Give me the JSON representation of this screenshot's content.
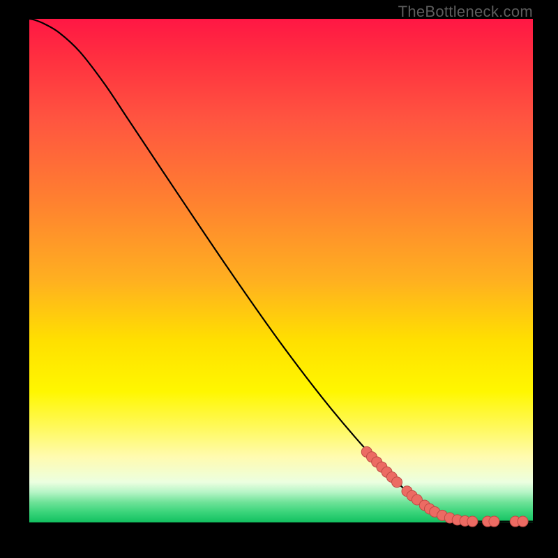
{
  "watermark": "TheBottleneck.com",
  "colors": {
    "background": "#000000",
    "curve": "#000000",
    "dot_fill": "#ec6b63",
    "dot_stroke": "#be4a44"
  },
  "chart_data": {
    "type": "line",
    "title": "",
    "xlabel": "",
    "ylabel": "",
    "xlim": [
      0,
      100
    ],
    "ylim": [
      0,
      100
    ],
    "grid": false,
    "curve": [
      {
        "x": 0.0,
        "y": 100.0
      },
      {
        "x": 1.0,
        "y": 99.8
      },
      {
        "x": 3.0,
        "y": 99.0
      },
      {
        "x": 6.0,
        "y": 97.2
      },
      {
        "x": 10.0,
        "y": 93.5
      },
      {
        "x": 15.0,
        "y": 87.0
      },
      {
        "x": 20.0,
        "y": 79.5
      },
      {
        "x": 30.0,
        "y": 64.5
      },
      {
        "x": 40.0,
        "y": 49.7
      },
      {
        "x": 50.0,
        "y": 35.5
      },
      {
        "x": 60.0,
        "y": 22.5
      },
      {
        "x": 70.0,
        "y": 11.0
      },
      {
        "x": 75.0,
        "y": 6.2
      },
      {
        "x": 80.0,
        "y": 2.5
      },
      {
        "x": 83.0,
        "y": 1.0
      },
      {
        "x": 86.0,
        "y": 0.35
      },
      {
        "x": 90.0,
        "y": 0.2
      },
      {
        "x": 95.0,
        "y": 0.2
      },
      {
        "x": 100.0,
        "y": 0.2
      }
    ],
    "dots": [
      {
        "x": 67.0,
        "y": 14.0
      },
      {
        "x": 68.0,
        "y": 13.0
      },
      {
        "x": 69.0,
        "y": 12.0
      },
      {
        "x": 70.0,
        "y": 11.0
      },
      {
        "x": 71.0,
        "y": 10.0
      },
      {
        "x": 72.0,
        "y": 9.0
      },
      {
        "x": 73.0,
        "y": 8.0
      },
      {
        "x": 75.0,
        "y": 6.2
      },
      {
        "x": 76.0,
        "y": 5.3
      },
      {
        "x": 77.0,
        "y": 4.5
      },
      {
        "x": 78.5,
        "y": 3.4
      },
      {
        "x": 79.5,
        "y": 2.7
      },
      {
        "x": 80.5,
        "y": 2.1
      },
      {
        "x": 82.0,
        "y": 1.4
      },
      {
        "x": 83.5,
        "y": 0.9
      },
      {
        "x": 85.0,
        "y": 0.5
      },
      {
        "x": 86.5,
        "y": 0.3
      },
      {
        "x": 88.0,
        "y": 0.2
      },
      {
        "x": 91.0,
        "y": 0.2
      },
      {
        "x": 92.3,
        "y": 0.2
      },
      {
        "x": 96.5,
        "y": 0.2
      },
      {
        "x": 98.0,
        "y": 0.2
      }
    ]
  }
}
